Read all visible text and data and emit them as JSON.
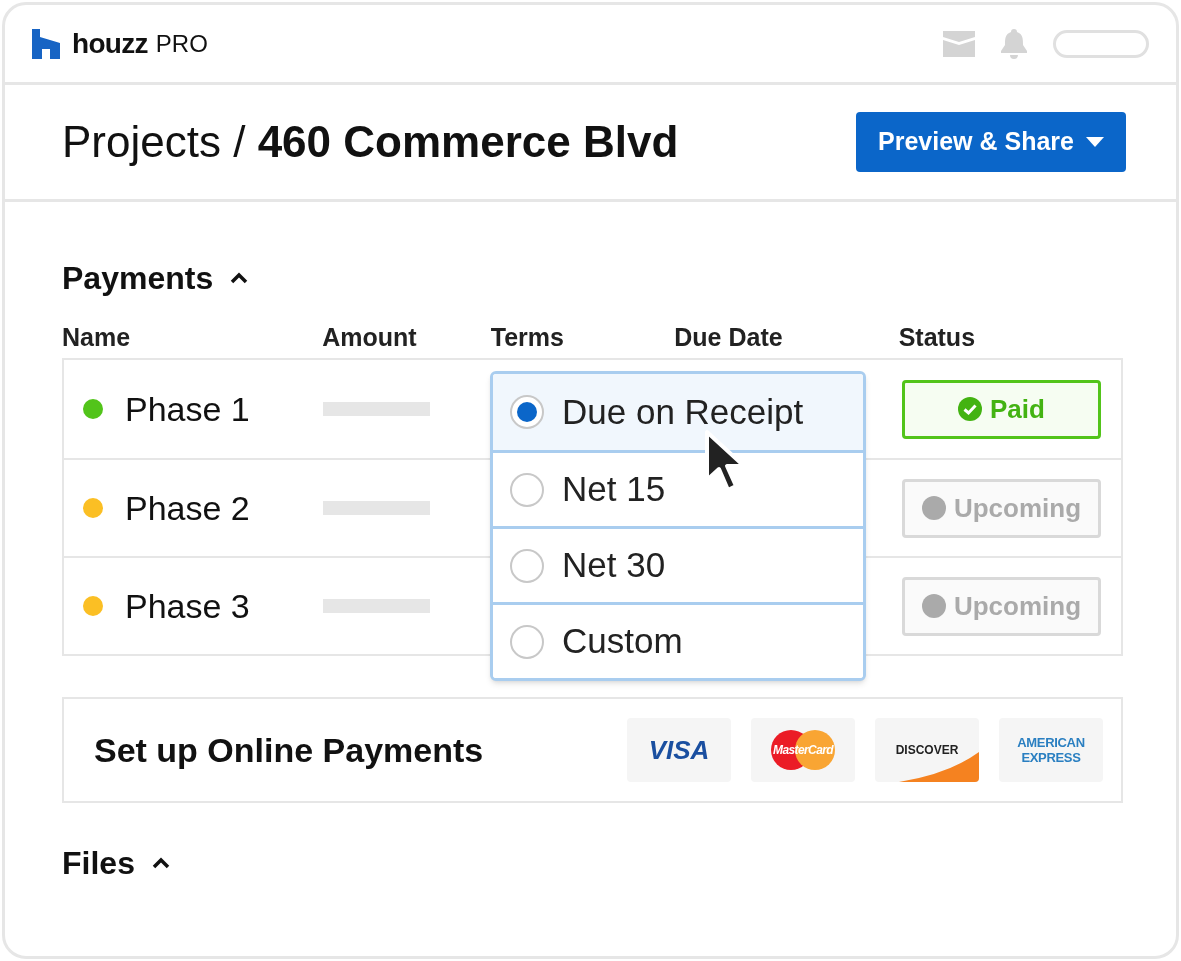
{
  "brand": {
    "name": "houzz",
    "suffix": "PRO"
  },
  "page_title": "Projects / **460 Commerce Blvd**",
  "share_button": "Preview & Share",
  "payments": {
    "title": "Payments",
    "expanded": true,
    "columns": [
      "Name",
      "Amount",
      "Terms",
      "Due Date",
      "Status"
    ],
    "rows": [
      {
        "name": "Phase 1",
        "color": "#52c41a",
        "status": {
          "kind": "paid",
          "label": "Paid"
        }
      },
      {
        "name": "Phase 2",
        "color": "#fbbf24",
        "status": {
          "kind": "upcoming",
          "label": "Upcoming"
        }
      },
      {
        "name": "Phase 3",
        "color": "#fbbf24",
        "status": {
          "kind": "upcoming",
          "label": "Upcoming"
        }
      }
    ],
    "terms_menu": [
      {
        "label": "Due on Receipt",
        "selected": true
      },
      {
        "label": "Net 15",
        "selected": false
      },
      {
        "label": "Net 30",
        "selected": false
      },
      {
        "label": "Custom",
        "selected": false
      }
    ]
  },
  "online_payments": {
    "title": "Set up Online Payments",
    "cards": [
      {
        "kind": "visa",
        "lines": [
          "VISA"
        ]
      },
      {
        "kind": "mastercard",
        "lines": [
          "MasterCard"
        ]
      },
      {
        "kind": "discover",
        "lines": [
          "DISCOVER"
        ]
      },
      {
        "kind": "amex",
        "lines": [
          "AMERICAN",
          "EXPRESS"
        ]
      }
    ]
  },
  "files": {
    "title": "Files",
    "expanded": true
  }
}
